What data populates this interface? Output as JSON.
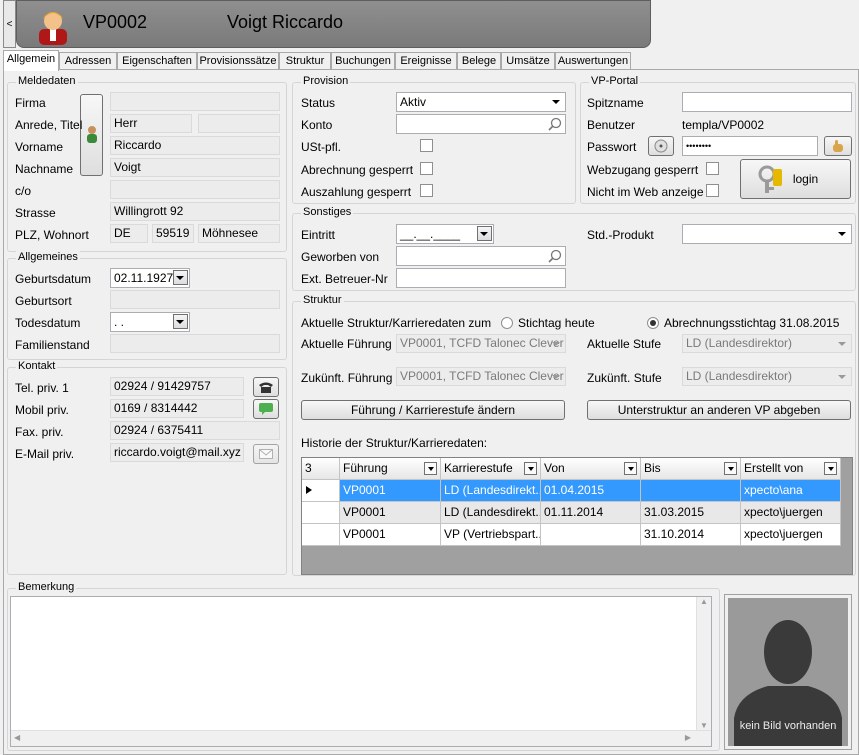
{
  "header": {
    "code": "VP0002",
    "name": "Voigt Riccardo",
    "back": "<"
  },
  "tabs": [
    "Allgemein",
    "Adressen",
    "Eigenschaften",
    "Provisionssätze",
    "Struktur",
    "Buchungen",
    "Ereignisse",
    "Belege",
    "Umsätze",
    "Auswertungen"
  ],
  "meldedaten": {
    "title": "Meldedaten",
    "firma_label": "Firma",
    "anrede_label": "Anrede, Titel",
    "anrede": "Herr",
    "vorname_label": "Vorname",
    "vorname": "Riccardo",
    "nachname_label": "Nachname",
    "nachname": "Voigt",
    "co_label": "c/o",
    "strasse_label": "Strasse",
    "strasse": "Willingrott 92",
    "plz_label": "PLZ, Wohnort",
    "land": "DE",
    "plz": "59519",
    "ort": "Möhnesee"
  },
  "allgemeines": {
    "title": "Allgemeines",
    "geburtsdatum_label": "Geburtsdatum",
    "geburtsdatum": "02.11.1927",
    "geburtsort_label": "Geburtsort",
    "todesdatum_label": "Todesdatum",
    "todesdatum": " .  .",
    "familienstand_label": "Familienstand"
  },
  "kontakt": {
    "title": "Kontakt",
    "tel_label": "Tel. priv. 1",
    "tel": "02924 / 91429757",
    "mobil_label": "Mobil priv.",
    "mobil": "0169 / 8314442",
    "fax_label": "Fax. priv.",
    "fax": "02924 / 6375411",
    "email_label": "E-Mail priv.",
    "email": "riccardo.voigt@mail.xyz"
  },
  "provision": {
    "title": "Provision",
    "status_label": "Status",
    "status": "Aktiv",
    "konto_label": "Konto",
    "ust_label": "USt-pfl.",
    "abrechnung_label": "Abrechnung gesperrt",
    "auszahlung_label": "Auszahlung gesperrt"
  },
  "vpportal": {
    "title": "VP-Portal",
    "spitzname_label": "Spitzname",
    "benutzer_label": "Benutzer",
    "benutzer": "templa/VP0002",
    "passwort_label": "Passwort",
    "passwort": "••••••••",
    "webzugang_label": "Webzugang gesperrt",
    "nichtimweb_label": "Nicht im Web anzeige",
    "login": "login"
  },
  "sonstiges": {
    "title": "Sonstiges",
    "eintritt_label": "Eintritt",
    "eintritt": "__.__.____",
    "geworben_label": "Geworben von",
    "extbetreuer_label": "Ext. Betreuer-Nr",
    "stdprodukt_label": "Std.-Produkt"
  },
  "struktur": {
    "title": "Struktur",
    "aktuelle_label": "Aktuelle Struktur/Karrieredaten zum",
    "radio1": "Stichtag heute",
    "radio2": "Abrechnungsstichtag 31.08.2015",
    "akt_fuehrung_label": "Aktuelle Führung",
    "akt_fuehrung": "VP0001, TCFD Talonec Clever",
    "akt_stufe_label": "Aktuelle Stufe",
    "akt_stufe": "LD (Landesdirektor)",
    "zuk_fuehrung_label": "Zukünft. Führung",
    "zuk_fuehrung": "VP0001, TCFD Talonec Clever",
    "zuk_stufe_label": "Zukünft. Stufe",
    "zuk_stufe": "LD (Landesdirektor)",
    "btn_fuehrung": "Führung / Karrierestufe ändern",
    "btn_unterstruktur": "Unterstruktur an anderen VP abgeben",
    "historie_label": "Historie der Struktur/Karrieredaten:"
  },
  "historie": {
    "count": "3",
    "columns": [
      "Führung",
      "Karrierestufe",
      "Von",
      "Bis",
      "Erstellt von"
    ],
    "rows": [
      [
        "VP0001",
        "LD (Landesdirekt...",
        "01.04.2015",
        "",
        "xpecto\\ana"
      ],
      [
        "VP0001",
        "LD (Landesdirekt...",
        "01.11.2014",
        "31.03.2015",
        "xpecto\\juergen"
      ],
      [
        "VP0001",
        "VP (Vertriebspart...",
        "",
        "31.10.2014",
        "xpecto\\juergen"
      ]
    ]
  },
  "bemerkung": {
    "title": "Bemerkung"
  },
  "photo": {
    "caption": "kein Bild vorhanden"
  },
  "colors": {
    "selected": "#3399ff",
    "header_bg": "#838383"
  }
}
